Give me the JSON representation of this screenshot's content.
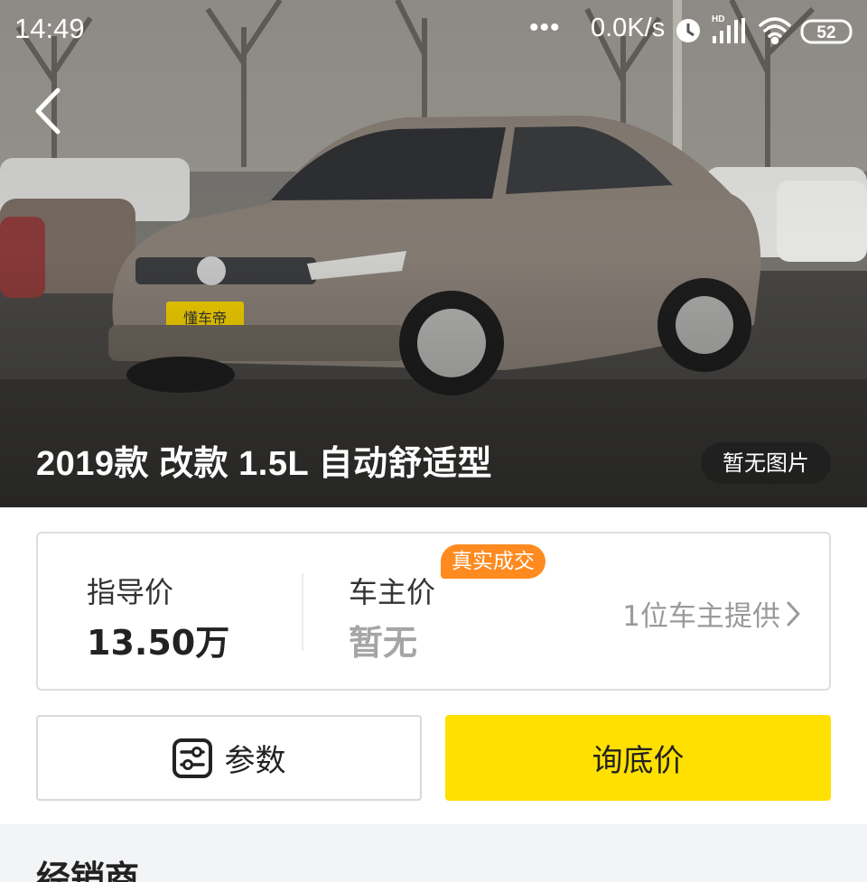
{
  "status_bar": {
    "time": "14:49",
    "dots": "•••",
    "network_speed": "0.0K/s",
    "signal_tag": "HD",
    "battery": "52"
  },
  "hero": {
    "title": "2019款 改款 1.5L 自动舒适型",
    "no_image_label": "暂无图片",
    "plate_text": "懂车帝"
  },
  "price_card": {
    "guide_label": "指导价",
    "guide_value": "13.50万",
    "owner_label": "车主价",
    "owner_value": "暂无",
    "deal_badge": "真实成交",
    "owners_link": "1位车主提供"
  },
  "actions": {
    "params_label": "参数",
    "inquiry_label": "询底价"
  },
  "dealer": {
    "title": "经销商"
  },
  "colors": {
    "accent_yellow": "#ffe000",
    "badge_orange": "#ff8a1f",
    "muted_text": "#9a9a9a"
  },
  "icons": {
    "back": "chevron-left-icon",
    "params": "sliders-icon",
    "link_arrow": "chevron-right-icon",
    "alarm": "alarm-clock-icon",
    "signal": "signal-bars-icon",
    "wifi": "wifi-icon",
    "battery": "battery-icon"
  }
}
